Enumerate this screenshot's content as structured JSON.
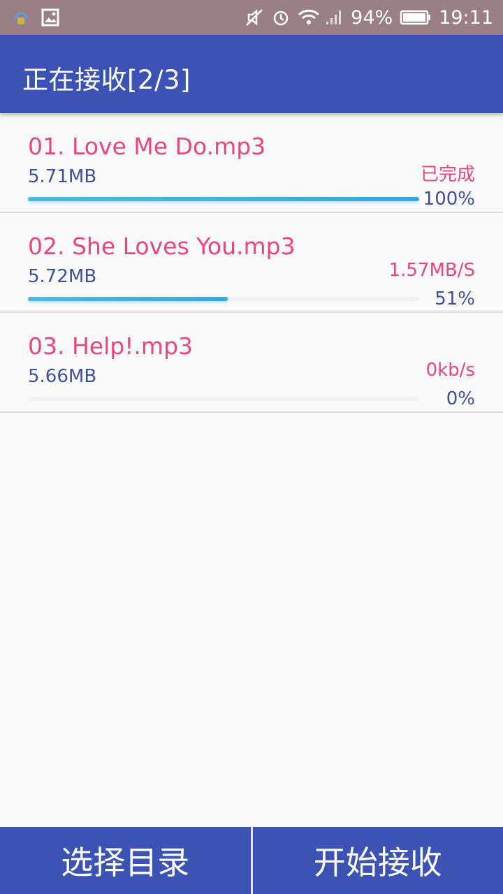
{
  "status_bar": {
    "battery": "94%",
    "time": "19:11",
    "icons": [
      "bluetooth-lock-icon",
      "image-icon",
      "mute-icon",
      "alarm-icon",
      "wifi-icon",
      "signal-icon",
      "battery-icon"
    ]
  },
  "app_bar": {
    "title": "正在接收[2/3]"
  },
  "files": [
    {
      "name": "01. Love Me Do.mp3",
      "size": "5.71MB",
      "status": "已完成",
      "percent": "100%",
      "progress": 1.0
    },
    {
      "name": "02. She Loves You.mp3",
      "size": "5.72MB",
      "status": "1.57MB/S",
      "percent": "51%",
      "progress": 0.51
    },
    {
      "name": "03. Help!.mp3",
      "size": "5.66MB",
      "status": "0kb/s",
      "percent": "0%",
      "progress": 0.0
    }
  ],
  "bottom": {
    "choose_dir": "选择目录",
    "start_receive": "开始接收"
  },
  "colors": {
    "primary": "#3d52b5",
    "accent": "#e8467c",
    "text_blue": "#3d4f9e",
    "progress": "#3aa8dc",
    "status_bar": "#9a7f86"
  }
}
